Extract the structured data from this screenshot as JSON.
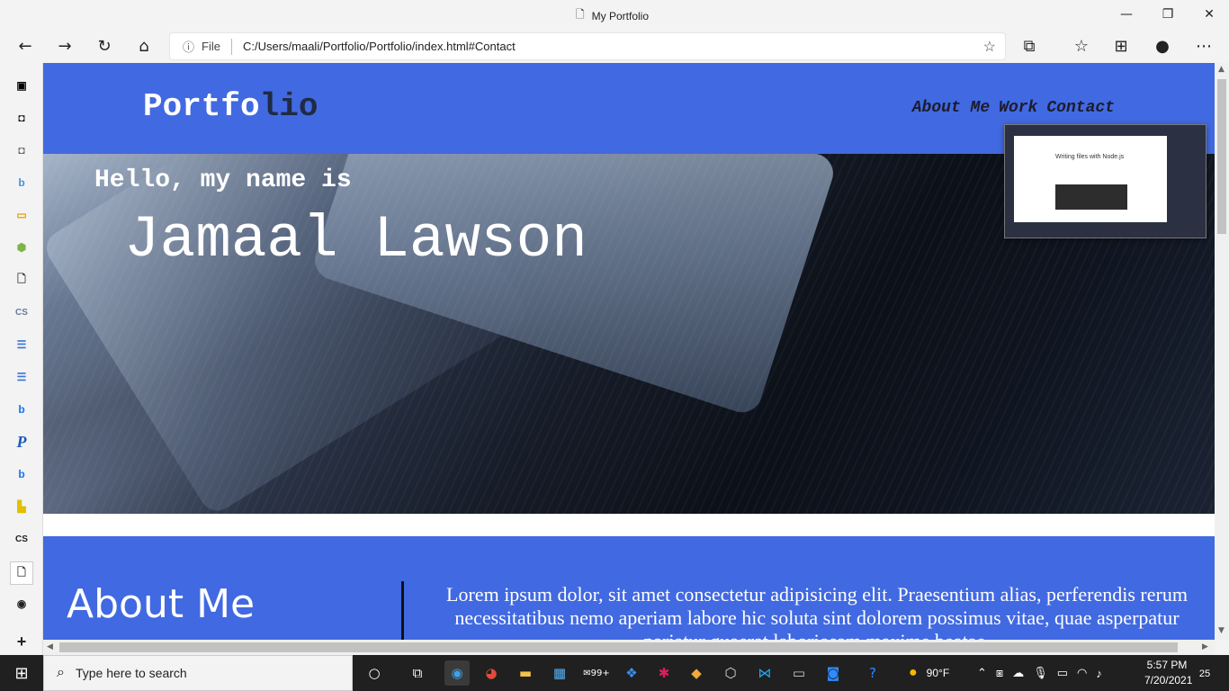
{
  "window": {
    "title": "My Portfolio",
    "minimize": "—",
    "restore": "❐",
    "close": "✕"
  },
  "browser": {
    "url_label": "File",
    "url": "C:/Users/maali/Portfolio/Portfolio/index.html#Contact"
  },
  "site": {
    "logo_light": "Portfo",
    "logo_dark": "lio",
    "nav": [
      "About Me",
      "Work",
      "Contact"
    ],
    "hello": "Hello, my name is",
    "name": "Jamaal Lawson",
    "about_heading": "About Me",
    "about_text": "Lorem ipsum dolor, sit amet consectetur adipisicing elit. Praesentium alias, perferendis rerum necessitatibus nemo aperiam labore hic soluta sint dolorem possimus vitae, quae asperpatur pariatur quaerat laboriosam maxime beatae."
  },
  "preview": {
    "title": "Writing files with Node.js"
  },
  "taskbar": {
    "search_placeholder": "Type here to search",
    "mail_badge": "99+",
    "weather": "90°F",
    "time": "5:57 PM",
    "date": "7/20/2021",
    "notifications": "25"
  },
  "colors": {
    "brand_blue": "#4169e1"
  }
}
